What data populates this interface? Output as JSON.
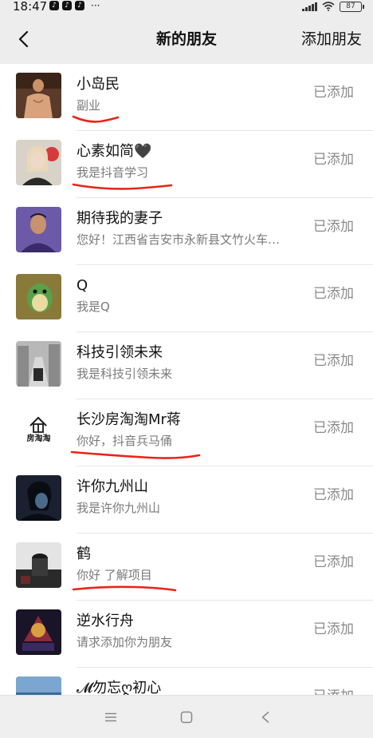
{
  "status_bar": {
    "time": "18:47",
    "app_icons": [
      "tiktok-icon",
      "tiktok-icon",
      "tiktok-icon"
    ],
    "more": "···",
    "battery": "87"
  },
  "header": {
    "title": "新的朋友",
    "add_friend": "添加朋友",
    "back_icon": "chevron-left-icon"
  },
  "friends": [
    {
      "name": "小岛民",
      "message": "副业",
      "status": "已添加"
    },
    {
      "name": "心素如简🖤",
      "message": "我是抖音学习",
      "status": "已添加"
    },
    {
      "name": "期待我的妻子",
      "message": "您好！江西省吉安市永新县文竹火车…",
      "status": "已添加"
    },
    {
      "name": "Q",
      "message": "我是Q",
      "status": "已添加"
    },
    {
      "name": "科技引领未来",
      "message": "我是科技引领未来",
      "status": "已添加"
    },
    {
      "name": "长沙房淘淘Mr蒋",
      "message": "你好，抖音兵马俑",
      "status": "已添加",
      "avatar_text": "房淘淘"
    },
    {
      "name": "许你九州山",
      "message": "我是许你九州山",
      "status": "已添加"
    },
    {
      "name": "鹤",
      "message": "你好 了解项目",
      "status": "已添加"
    },
    {
      "name": "逆水行舟",
      "message": "请求添加你为朋友",
      "status": "已添加"
    },
    {
      "name": "𝓜勿忘ღ初心",
      "message": "",
      "status": "已添加"
    }
  ],
  "nav": {
    "menu_icon": "menu-icon",
    "home_icon": "square-home-icon",
    "back_icon": "triangle-back-icon"
  },
  "colors": {
    "annotation_underline": "#e8251a",
    "status_text": "#8a8a8a",
    "background": "#ededed"
  }
}
